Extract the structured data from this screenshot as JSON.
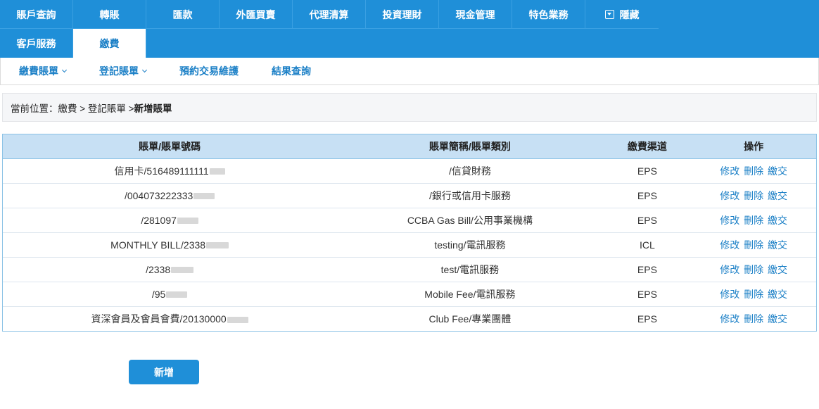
{
  "nav": {
    "row1": [
      "賬戶查詢",
      "轉賬",
      "匯款",
      "外匯買賣",
      "代理清算",
      "投資理財",
      "現金管理",
      "特色業務"
    ],
    "hide_label": "隱藏",
    "row2": [
      "客戶服務",
      "繳費"
    ],
    "active": "繳費"
  },
  "subnav": {
    "items": [
      {
        "label": "繳費賬單",
        "dropdown": true
      },
      {
        "label": "登記賬單",
        "dropdown": true
      },
      {
        "label": "預約交易維護",
        "dropdown": false
      },
      {
        "label": "結果查詢",
        "dropdown": false
      }
    ]
  },
  "breadcrumb": {
    "prefix": "當前位置：繳費 > 登記賬單 > ",
    "current": "新增賬單"
  },
  "table": {
    "headers": [
      "賬單/賬單號碼",
      "賬單簡稱/賬單類別",
      "繳費渠道",
      "操作"
    ],
    "actions": [
      "修改",
      "刪除",
      "繳交"
    ],
    "rows": [
      {
        "bill": "信用卡/516489111111",
        "category": "/信貸財務",
        "channel": "EPS"
      },
      {
        "bill": "/004073222333",
        "category": "/銀行或信用卡服務",
        "channel": "EPS"
      },
      {
        "bill": "/281097",
        "category": "CCBA Gas Bill/公用事業機構",
        "channel": "EPS"
      },
      {
        "bill": "MONTHLY BILL/2338",
        "category": "testing/電訊服務",
        "channel": "ICL"
      },
      {
        "bill": "/2338",
        "category": "test/電訊服務",
        "channel": "EPS"
      },
      {
        "bill": "/95",
        "category": "Mobile Fee/電訊服務",
        "channel": "EPS"
      },
      {
        "bill": "資深會員及會員會費/20130000",
        "category": "Club Fee/專業團體",
        "channel": "EPS"
      }
    ]
  },
  "add_button": "新增",
  "colors": {
    "primary": "#1f8fd8",
    "link": "#1a7fc6",
    "header_bg": "#c7e0f4"
  }
}
